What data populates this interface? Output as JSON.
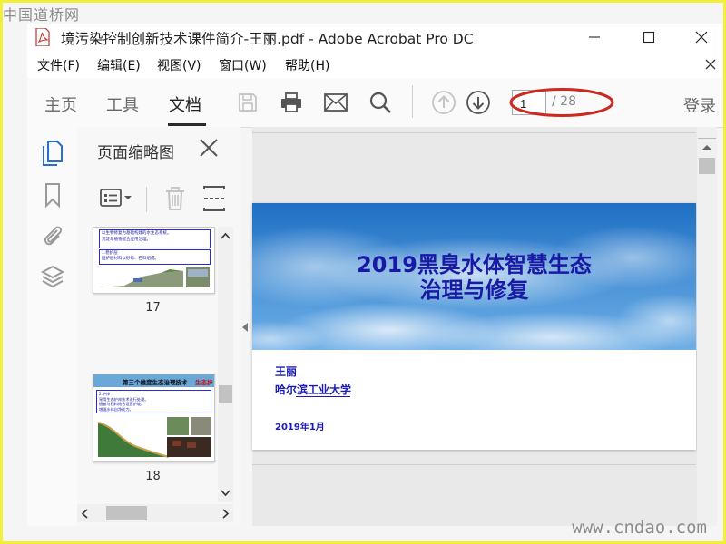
{
  "watermarks": {
    "top": "中国道桥网",
    "bottom": "www.cndao.com"
  },
  "window": {
    "title": "境污染控制创新技术课件简介-王丽.pdf - Adobe Acrobat Pro DC"
  },
  "menu": {
    "items": [
      "文件(F)",
      "编辑(E)",
      "视图(V)",
      "窗口(W)",
      "帮助(H)"
    ]
  },
  "toolbar": {
    "tabs": [
      "主页",
      "工具",
      "文档"
    ],
    "active_tab": "文档",
    "icons": [
      "save-icon",
      "print-icon",
      "mail-icon",
      "search-icon",
      "previous-page-icon",
      "next-page-icon"
    ],
    "page_current": "1",
    "page_total": "/ 28",
    "login": "登录",
    "annotation_color": "#cc2a1f"
  },
  "side_panel": {
    "title": "页面缩略图",
    "thumbnails": [
      {
        "page_label": "17",
        "heading_lines": [
          "以生物修复为基础构建的水生态系统。",
          "沉淀与植物配合应用治理。"
        ],
        "section_tag": "1.稳护层",
        "body_lines": [
          "固护层材料以砂砾、石料组成。"
        ]
      },
      {
        "page_label": "18",
        "header": "第三个维度生态治理技术",
        "header_highlight": "生态护",
        "section_tag": "2.护岸",
        "body_lines": [
          "采用生态护岸技术进行处理。",
          "植被与石料结合设置护坡。",
          "增强水体自净能力。"
        ]
      }
    ]
  },
  "slide": {
    "title_line1": "2019黑臭水体智慧生态",
    "title_line2": "治理与修复",
    "author": "王丽",
    "university": "哈尔滨工业大学",
    "date": "2019年1月",
    "text_color": "#1b1bb3"
  },
  "colors": {
    "frame_border": "#f2ee3a",
    "pdf_red": "#c9302c"
  }
}
